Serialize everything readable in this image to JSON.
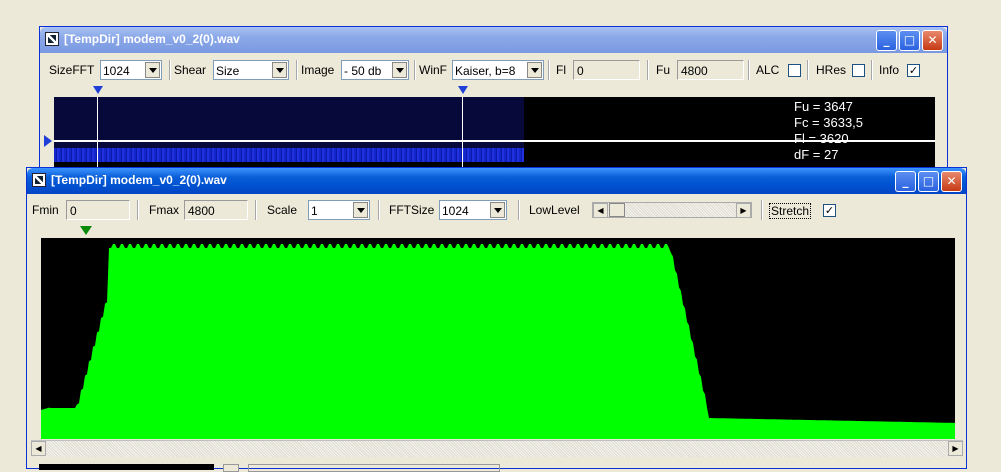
{
  "back_window": {
    "title": "[TempDir] modem_v0_2(0).wav",
    "toolbar": {
      "sizefft_label": "SizeFFT",
      "sizefft_value": "1024",
      "shear_label": "Shear",
      "shear_value": "Size",
      "image_label": "Image",
      "image_value": "- 50 db",
      "winf_label": "WinF",
      "winf_value": "Kaiser, b=8",
      "fl_label": "Fl",
      "fl_value": "0",
      "fu_label": "Fu",
      "fu_value": "4800",
      "alc_label": "ALC",
      "hres_label": "HRes",
      "info_label": "Info",
      "info_checked": "✓"
    },
    "info": {
      "fu": "Fu = 3647",
      "fc": "Fc = 3633,5",
      "fl": "Fl = 3620",
      "df": "dF = 27"
    }
  },
  "front_window": {
    "title": "[TempDir] modem_v0_2(0).wav",
    "toolbar": {
      "fmin_label": "Fmin",
      "fmin_value": "0",
      "fmax_label": "Fmax",
      "fmax_value": "4800",
      "scale_label": "Scale",
      "scale_value": "1",
      "fftsize_label": "FFTSize",
      "fftsize_value": "1024",
      "lowlevel_label": "LowLevel",
      "stretch_label": "Stretch",
      "stretch_checked": "✓"
    },
    "spectrum_color": "#00ff00"
  },
  "colors": {
    "titlebar_active": "#0a5fd8",
    "titlebar_inactive": "#8aa8e8",
    "spectrum": "#00ff00",
    "marker_blue": "#1f3fd8",
    "marker_green": "#0a8a0a"
  }
}
